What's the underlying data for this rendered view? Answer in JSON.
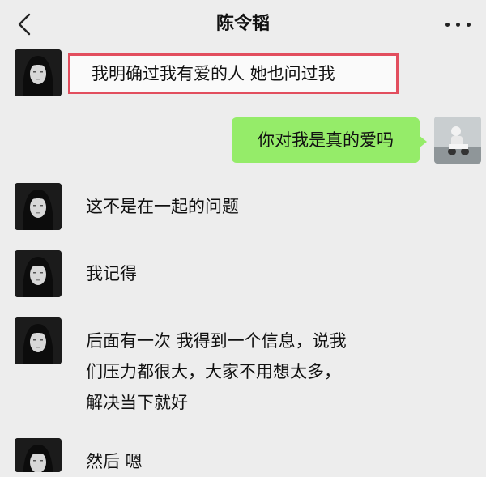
{
  "header": {
    "title": "陈令韬",
    "back_icon": "chevron-left-icon",
    "more_icon": "more-dots-icon"
  },
  "messages": [
    {
      "side": "left",
      "text": "我明确过我有爱的人 她也问过我",
      "highlighted": true
    },
    {
      "side": "right",
      "text": "你对我是真的爱吗"
    },
    {
      "side": "left",
      "text": "这不是在一起的问题"
    },
    {
      "side": "left",
      "text": "我记得"
    },
    {
      "side": "left",
      "lines": [
        "后面有一次 我得到一个信息，说我",
        "们压力都很大，大家不用想太多，",
        "解决当下就好"
      ]
    },
    {
      "side": "left",
      "text": "然后 嗯"
    }
  ],
  "colors": {
    "background": "#ededed",
    "bubble_right": "#95ec69",
    "highlight_border": "#e24e5e"
  }
}
